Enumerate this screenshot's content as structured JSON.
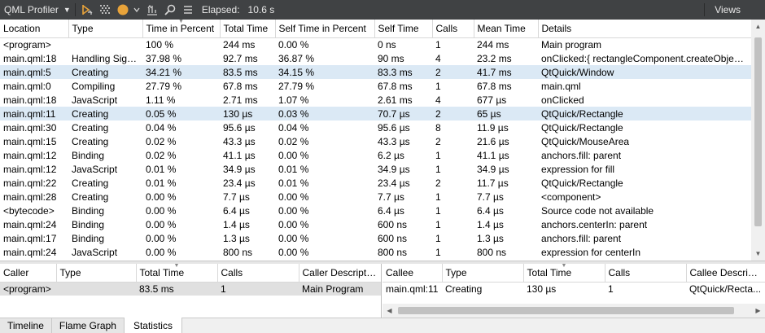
{
  "toolbar": {
    "title": "QML Profiler",
    "elapsed_label": "Elapsed:",
    "elapsed_value": "10.6 s",
    "views_label": "Views",
    "icons": [
      "chevron-down-icon",
      "play-record-icon",
      "clear-icon",
      "record-circle-icon",
      "filter-icon",
      "search-icon",
      "hamburger-icon"
    ],
    "record_color": "#e8a33a"
  },
  "main_table": {
    "headers": [
      "Location",
      "Type",
      "Time in Percent",
      "Total Time",
      "Self Time in Percent",
      "Self Time",
      "Calls",
      "Mean Time",
      "Details"
    ],
    "rows": [
      [
        "<program>",
        "",
        "100 %",
        "244 ms",
        "0.00 %",
        "0 ns",
        "1",
        "244 ms",
        "Main program"
      ],
      [
        "main.qml:18",
        "Handling Signal",
        "37.98 %",
        "92.7 ms",
        "36.87 %",
        "90 ms",
        "4",
        "23.2 ms",
        "onClicked:{ rectangleComponent.createObject..."
      ],
      [
        "main.qml:5",
        "Creating",
        "34.21 %",
        "83.5 ms",
        "34.15 %",
        "83.3 ms",
        "2",
        "41.7 ms",
        "QtQuick/Window"
      ],
      [
        "main.qml:0",
        "Compiling",
        "27.79 %",
        "67.8 ms",
        "27.79 %",
        "67.8 ms",
        "1",
        "67.8 ms",
        "main.qml"
      ],
      [
        "main.qml:18",
        "JavaScript",
        "1.11 %",
        "2.71 ms",
        "1.07 %",
        "2.61 ms",
        "4",
        "677 µs",
        "onClicked"
      ],
      [
        "main.qml:11",
        "Creating",
        "0.05 %",
        "130 µs",
        "0.03 %",
        "70.7 µs",
        "2",
        "65 µs",
        "QtQuick/Rectangle"
      ],
      [
        "main.qml:30",
        "Creating",
        "0.04 %",
        "95.6 µs",
        "0.04 %",
        "95.6 µs",
        "8",
        "11.9 µs",
        "QtQuick/Rectangle"
      ],
      [
        "main.qml:15",
        "Creating",
        "0.02 %",
        "43.3 µs",
        "0.02 %",
        "43.3 µs",
        "2",
        "21.6 µs",
        "QtQuick/MouseArea"
      ],
      [
        "main.qml:12",
        "Binding",
        "0.02 %",
        "41.1 µs",
        "0.00 %",
        "6.2 µs",
        "1",
        "41.1 µs",
        "anchors.fill: parent"
      ],
      [
        "main.qml:12",
        "JavaScript",
        "0.01 %",
        "34.9 µs",
        "0.01 %",
        "34.9 µs",
        "1",
        "34.9 µs",
        "expression for fill"
      ],
      [
        "main.qml:22",
        "Creating",
        "0.01 %",
        "23.4 µs",
        "0.01 %",
        "23.4 µs",
        "2",
        "11.7 µs",
        "QtQuick/Rectangle"
      ],
      [
        "main.qml:28",
        "Creating",
        "0.00 %",
        "7.7 µs",
        "0.00 %",
        "7.7 µs",
        "1",
        "7.7 µs",
        "<component>"
      ],
      [
        "<bytecode>",
        "Binding",
        "0.00 %",
        "6.4 µs",
        "0.00 %",
        "6.4 µs",
        "1",
        "6.4 µs",
        "Source code not available"
      ],
      [
        "main.qml:24",
        "Binding",
        "0.00 %",
        "1.4 µs",
        "0.00 %",
        "600 ns",
        "1",
        "1.4 µs",
        "anchors.centerIn: parent"
      ],
      [
        "main.qml:17",
        "Binding",
        "0.00 %",
        "1.3 µs",
        "0.00 %",
        "600 ns",
        "1",
        "1.3 µs",
        "anchors.fill: parent"
      ],
      [
        "main.qml:24",
        "JavaScript",
        "0.00 %",
        "800 ns",
        "0.00 %",
        "800 ns",
        "1",
        "800 ns",
        "expression for centerIn"
      ]
    ],
    "highlighted_rows": [
      2,
      5
    ],
    "selection_color": "#dbe9f5"
  },
  "caller_table": {
    "headers": [
      "Caller",
      "Type",
      "Total Time",
      "Calls",
      "Caller Description"
    ],
    "rows": [
      [
        "<program>",
        "",
        "83.5 ms",
        "1",
        "Main Program"
      ]
    ]
  },
  "callee_table": {
    "headers": [
      "Callee",
      "Type",
      "Total Time",
      "Calls",
      "Callee Description"
    ],
    "rows": [
      [
        "main.qml:11",
        "Creating",
        "130 µs",
        "1",
        "QtQuick/Recta..."
      ]
    ]
  },
  "tabs": [
    {
      "label": "Timeline",
      "active": false
    },
    {
      "label": "Flame Graph",
      "active": false
    },
    {
      "label": "Statistics",
      "active": true
    }
  ]
}
